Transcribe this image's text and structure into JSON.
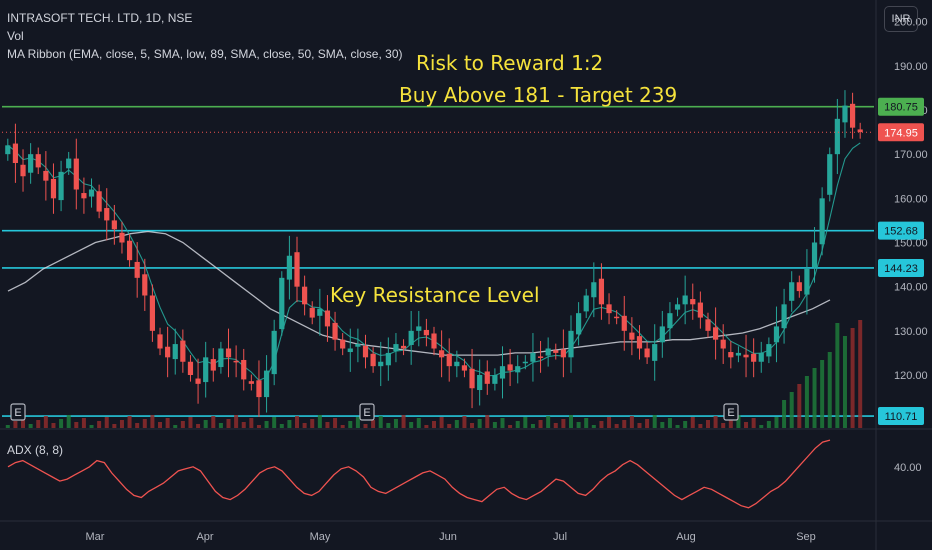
{
  "header": {
    "title": "INTRASOFT TECH. LTD, 1D, NSE",
    "volume_label": "Vol",
    "indicator_label": "MA Ribbon (EMA, close, 5, SMA, low, 89, SMA, close, 50, SMA, close, 30)"
  },
  "currency": "INR",
  "annotations": {
    "line1": "Risk to Reward 1:2",
    "line2": "Buy Above 181 - Target 239",
    "resistance": "Key Resistance Level"
  },
  "adx_title": "ADX (8, 8)",
  "earnings_marker": "E",
  "colors": {
    "background": "#131722",
    "up": "#26a69a",
    "down": "#ef5350",
    "resistance_line": "#26c6da",
    "buy_line": "#4caf50",
    "ma_long": "#d1d4dc",
    "ma_short": "#26a69a",
    "adx": "#ef5350",
    "annotation": "#f5e23c"
  },
  "chart_data": {
    "type": "candlestick",
    "price_axis": {
      "ticks": [
        200,
        190,
        180,
        170,
        160,
        150,
        140,
        130,
        120
      ],
      "tick_labels": [
        "200.00",
        "190.00",
        "180.00",
        "170.00",
        "160.00",
        "150.00",
        "140.00",
        "130.00",
        "120.00"
      ],
      "range": [
        108,
        204
      ]
    },
    "time_axis": {
      "labels": [
        "Mar",
        "Apr",
        "May",
        "Jun",
        "Jul",
        "Aug",
        "Sep"
      ]
    },
    "horizontal_levels": [
      {
        "value": 180.75,
        "label": "180.75",
        "color": "#4caf50"
      },
      {
        "value": 152.68,
        "label": "152.68",
        "color": "#26c6da"
      },
      {
        "value": 144.23,
        "label": "144.23",
        "color": "#26c6da"
      },
      {
        "value": 110.71,
        "label": "110.71",
        "color": "#26c6da"
      }
    ],
    "last_price": {
      "value": 174.95,
      "label": "174.95"
    },
    "ohlc_close_path": [
      172,
      168,
      165,
      170,
      167,
      164,
      160,
      166,
      169,
      162,
      160,
      162,
      157,
      155,
      153,
      150,
      146,
      142,
      138,
      130,
      126,
      124,
      127,
      123,
      120,
      118,
      124,
      121,
      126,
      124,
      123,
      119,
      118,
      115,
      121,
      130,
      142,
      147,
      140,
      136,
      133,
      135,
      131,
      128,
      126,
      126,
      127,
      124,
      122,
      123,
      125,
      127,
      126,
      130,
      131,
      129,
      126,
      124,
      122,
      123,
      121,
      117,
      120,
      118,
      120,
      122,
      121,
      122,
      123,
      125,
      124,
      126,
      125,
      124,
      130,
      134,
      138,
      141,
      136,
      134,
      133,
      130,
      128,
      126,
      124,
      127,
      131,
      134,
      136,
      138,
      136,
      133,
      130,
      128,
      126,
      124,
      125,
      124,
      123,
      125,
      127,
      131,
      136,
      141,
      139,
      144,
      150,
      160,
      170,
      178,
      181,
      176,
      175
    ],
    "ma_long_values": [
      139,
      141,
      144,
      146,
      148,
      150,
      151,
      152,
      152.5,
      152,
      150,
      147,
      144,
      141,
      138,
      135,
      133,
      131,
      129,
      128,
      127,
      126.5,
      126,
      125.5,
      125,
      124.5,
      124.5,
      124.5,
      124.5,
      125,
      125,
      125.5,
      126,
      126.5,
      127,
      127.5,
      127.5,
      127.5,
      128,
      128,
      128.5,
      129,
      129.5,
      130.5,
      132,
      133.5,
      135,
      137
    ],
    "adx": {
      "tick_labels": [
        "40.00"
      ],
      "range": [
        15,
        55
      ],
      "values": [
        40,
        42,
        43,
        41,
        39,
        37,
        35,
        33,
        34,
        36,
        38,
        40,
        43,
        42,
        37,
        33,
        29,
        26,
        25,
        28,
        30,
        32,
        35,
        38,
        39,
        40,
        38,
        33,
        28,
        25,
        24,
        26,
        29,
        33,
        37,
        39,
        40,
        38,
        34,
        30,
        27,
        26,
        28,
        32,
        36,
        39,
        40,
        38,
        35,
        30,
        28,
        27,
        29,
        31,
        33,
        35,
        37,
        38,
        36,
        34,
        30,
        27,
        25,
        24,
        23,
        26,
        29,
        30,
        27,
        25,
        24,
        26,
        28,
        31,
        34,
        33,
        30,
        27,
        26,
        29,
        33,
        36,
        38,
        41,
        43,
        41,
        38,
        35,
        32,
        29,
        26,
        24,
        26,
        28,
        30,
        29,
        27,
        25,
        23,
        21,
        20,
        22,
        25,
        28,
        30,
        33,
        37,
        41,
        45,
        49,
        52,
        53
      ]
    }
  }
}
